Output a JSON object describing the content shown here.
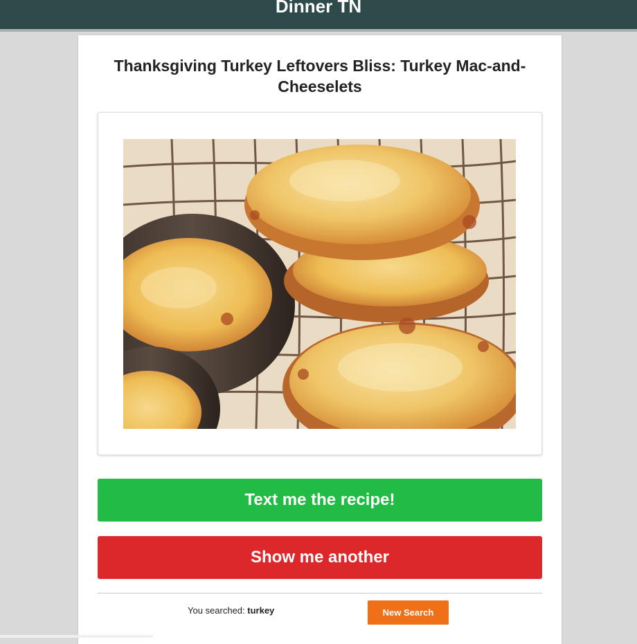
{
  "header": {
    "brand": "Dinner TN"
  },
  "recipe": {
    "title": "Thanksgiving Turkey Leftovers Bliss: Turkey Mac-and-Cheeselets",
    "image_alt": "Turkey mac-and-cheeselets on a cooling rack"
  },
  "actions": {
    "text_recipe_label": "Text me the recipe!",
    "show_another_label": "Show me another"
  },
  "search": {
    "prefix": "You searched:",
    "term": "turkey",
    "new_search_label": "New Search"
  },
  "colors": {
    "header_bg": "#2e4a4b",
    "text_button": "#21bb46",
    "another_button": "#dc282a",
    "new_search_button": "#f07019"
  }
}
